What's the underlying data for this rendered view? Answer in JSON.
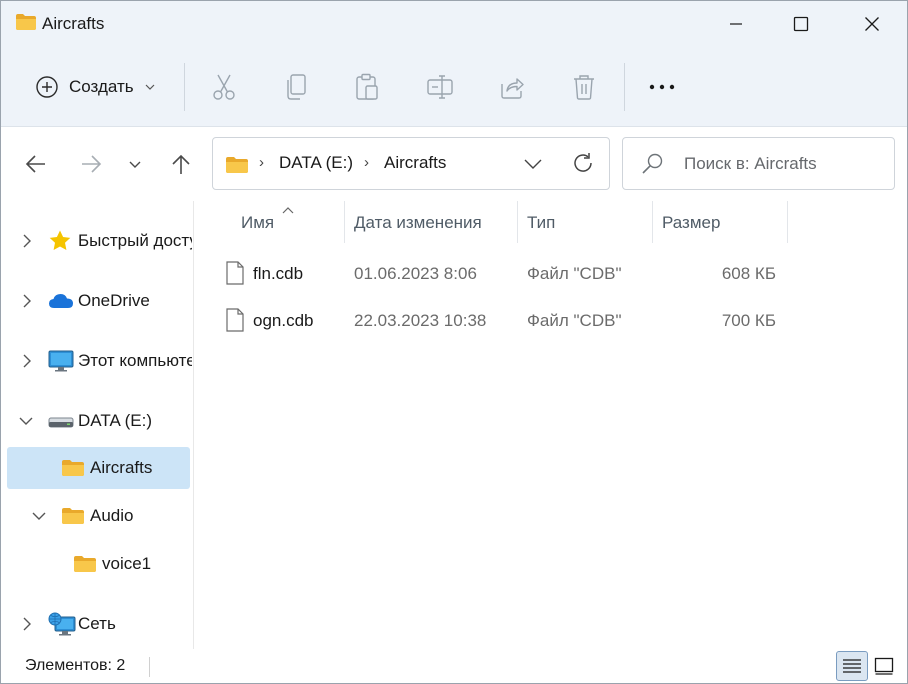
{
  "window": {
    "title": "Aircrafts",
    "icon": "folder-icon",
    "controls": [
      "minimize-icon",
      "maximize-icon",
      "close-icon"
    ]
  },
  "toolbar": {
    "create_label": "Создать",
    "icons": [
      "cut-icon",
      "copy-icon",
      "paste-icon",
      "rename-icon",
      "share-icon",
      "delete-icon"
    ],
    "more": "more-icon"
  },
  "address": {
    "crumbs": [
      "DATA (E:)",
      "Aircrafts"
    ]
  },
  "search": {
    "placeholder": "Поиск в: Aircrafts"
  },
  "nav": {
    "items": [
      {
        "label": "Быстрый доступ",
        "icon": "star-icon",
        "expanded": false
      },
      {
        "label": "OneDrive",
        "icon": "cloud-icon",
        "expanded": false
      },
      {
        "label": "Этот компьютер",
        "icon": "monitor-icon",
        "expanded": false
      },
      {
        "label": "DATA (E:)",
        "icon": "drive-icon",
        "expanded": true
      },
      {
        "label": "Aircrafts",
        "icon": "folder-icon",
        "selected": true
      },
      {
        "label": "Audio",
        "icon": "folder-icon",
        "expanded": true
      },
      {
        "label": "voice1",
        "icon": "folder-icon"
      },
      {
        "label": "Сеть",
        "icon": "network-icon",
        "expanded": false
      }
    ]
  },
  "columns": [
    "Имя",
    "Дата изменения",
    "Тип",
    "Размер"
  ],
  "files": [
    {
      "name": "fln.cdb",
      "modified": "01.06.2023 8:06",
      "type": "Файл \"CDB\"",
      "size": "608 КБ"
    },
    {
      "name": "ogn.cdb",
      "modified": "22.03.2023 10:38",
      "type": "Файл \"CDB\"",
      "size": "700 КБ"
    }
  ],
  "status": {
    "count_text": "Элементов: 2"
  },
  "colors": {
    "chrome_bg": "#eef3f9",
    "selection": "#cce4f7",
    "folder_yellow": "#f8c74a"
  }
}
